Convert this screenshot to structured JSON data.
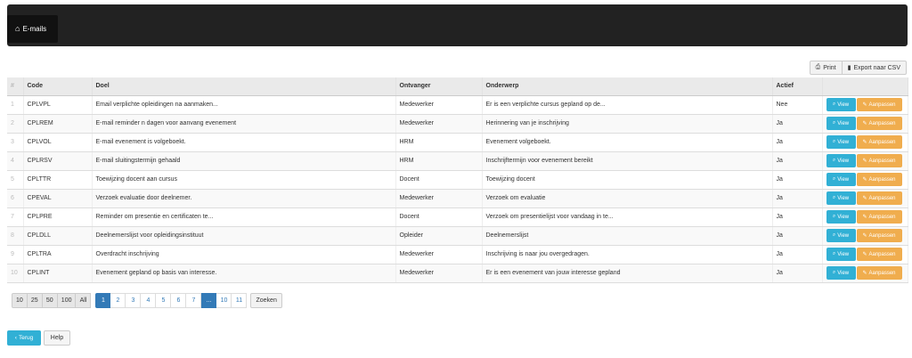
{
  "navbar": {
    "brand_icon": "home-icon",
    "brand_label": "E-mails"
  },
  "toolbar": {
    "print_label": "Print",
    "export_label": "Export naar CSV"
  },
  "table": {
    "headers": {
      "num": "#",
      "code": "Code",
      "doel": "Doel",
      "ontvanger": "Ontvanger",
      "onderwerp": "Onderwerp",
      "actief": "Actief"
    },
    "view_label": "View",
    "edit_label": "Aanpassen",
    "rows": [
      {
        "num": "1",
        "code": "CPLVPL",
        "doel": "Email verplichte opleidingen na aanmaken...",
        "ontvanger": "Medewerker",
        "onderwerp": "Er is een verplichte cursus gepland op de...",
        "actief": "Nee"
      },
      {
        "num": "2",
        "code": "CPLREM",
        "doel": "E-mail reminder n dagen voor aanvang evenement",
        "ontvanger": "Medewerker",
        "onderwerp": "Herinnering van je inschrijving",
        "actief": "Ja"
      },
      {
        "num": "3",
        "code": "CPLVOL",
        "doel": "E-mail evenement is volgeboekt.",
        "ontvanger": "HRM",
        "onderwerp": "Evenement volgeboekt.",
        "actief": "Ja"
      },
      {
        "num": "4",
        "code": "CPLRSV",
        "doel": "E-mail sluitingstermijn gehaald",
        "ontvanger": "HRM",
        "onderwerp": "Inschrijftermijn voor evenement bereikt",
        "actief": "Ja"
      },
      {
        "num": "5",
        "code": "CPLTTR",
        "doel": "Toewijzing docent aan cursus",
        "ontvanger": "Docent",
        "onderwerp": "Toewijzing docent",
        "actief": "Ja"
      },
      {
        "num": "6",
        "code": "CPEVAL",
        "doel": "Verzoek evaluatie door deelnemer.",
        "ontvanger": "Medewerker",
        "onderwerp": "Verzoek om evaluatie",
        "actief": "Ja"
      },
      {
        "num": "7",
        "code": "CPLPRE",
        "doel": "Reminder om presentie en certificaten te...",
        "ontvanger": "Docent",
        "onderwerp": "Verzoek om presentielijst voor vandaag in te...",
        "actief": "Ja"
      },
      {
        "num": "8",
        "code": "CPLDLL",
        "doel": "Deelnemerslijst voor opleidingsinstituut",
        "ontvanger": "Opleider",
        "onderwerp": "Deelnemerslijst",
        "actief": "Ja"
      },
      {
        "num": "9",
        "code": "CPLTRA",
        "doel": "Overdracht inschrijving",
        "ontvanger": "Medewerker",
        "onderwerp": "Inschrijving is naar jou overgedragen.",
        "actief": "Ja"
      },
      {
        "num": "10",
        "code": "CPLINT",
        "doel": "Evenement gepland op basis van interesse.",
        "ontvanger": "Medewerker",
        "onderwerp": "Er is een evenement van jouw interesse gepland",
        "actief": "Ja"
      }
    ]
  },
  "pager": {
    "page_sizes": [
      "10",
      "25",
      "50",
      "100",
      "All"
    ],
    "pages": [
      "1",
      "2",
      "3",
      "4",
      "5",
      "6",
      "7",
      "...",
      "10",
      "11"
    ],
    "selected_size": "10",
    "current_page": "1",
    "search_label": "Zoeken"
  },
  "footer": {
    "back_label": "Terug",
    "help_label": "Help"
  }
}
